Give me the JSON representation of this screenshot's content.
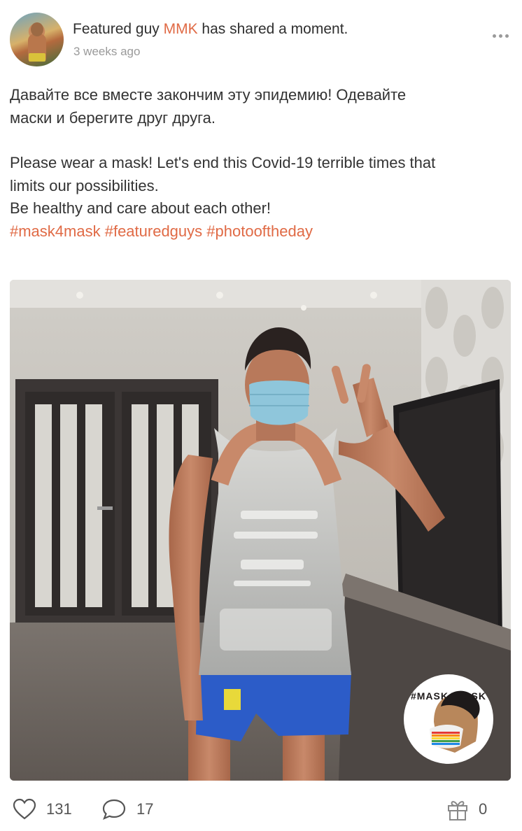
{
  "post": {
    "author_prefix": "Featured guy ",
    "author_name": "MMK",
    "action_text": " has shared a moment.",
    "timestamp": "3 weeks ago",
    "text_ru_line1": "Давайте все вместе закончим эту эпидемию! Одевайте",
    "text_ru_line2": "маски и берегите друг друга.",
    "text_en_line1": "Please wear a mask! Let's end this Covid-19 terrible times that",
    "text_en_line2": "limits our possibilities.",
    "text_en_line3": "Be healthy and care about each other!",
    "hashtags": [
      "#mask4mask",
      "#featuredguys",
      "#photooftheday"
    ]
  },
  "photo": {
    "badge_text": "#MASK4MASK"
  },
  "actions": {
    "likes": "131",
    "comments": "17",
    "gifts": "0"
  },
  "colors": {
    "accent": "#e06a45",
    "muted": "#9a9a9a",
    "text": "#333333"
  }
}
